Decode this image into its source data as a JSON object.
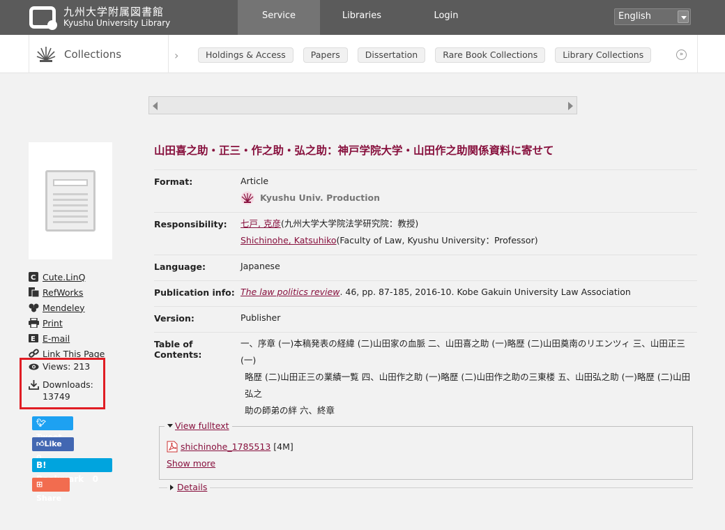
{
  "header": {
    "logo_jp": "九州大学附属図書館",
    "logo_en": "Kyushu University Library",
    "nav": [
      {
        "label": "Service"
      },
      {
        "label": "Libraries"
      },
      {
        "label": "Login"
      }
    ],
    "language": "English"
  },
  "collections_bar": {
    "title": "Collections",
    "pills": [
      "Holdings & Access",
      "Papers",
      "Dissertation",
      "Rare Book Collections",
      "Library Collections"
    ]
  },
  "sidebar": {
    "tools": [
      {
        "label": "Cute.LinQ",
        "icon": "cute-linq-icon"
      },
      {
        "label": "RefWorks",
        "icon": "refworks-icon"
      },
      {
        "label": "Mendeley",
        "icon": "mendeley-icon"
      },
      {
        "label": "Print",
        "icon": "print-icon"
      },
      {
        "label": "E-mail",
        "icon": "email-icon"
      },
      {
        "label": "Link This Page",
        "icon": "link-icon"
      }
    ],
    "views_label": "Views: 213",
    "downloads_label": "Downloads:",
    "downloads_value": "13749",
    "share": {
      "tweet": "Tweet",
      "like": "Like 0",
      "bookmark": "B! Bookmark",
      "bookmark_count": "0",
      "share": "Share"
    }
  },
  "record": {
    "title": "山田喜之助・正三・作之助・弘之助：神戸学院大学・山田作之助関係資料に寄せて",
    "format_label": "Format:",
    "format_value": "Article",
    "production": "Kyushu Univ. Production",
    "responsibility_label": "Responsibility:",
    "resp1_link": "七戸, 克彦",
    "resp1_rest": "(九州大学大学院法学研究院：教授)",
    "resp2_link": "Shichinohe, Katsuhiko",
    "resp2_rest": "(Faculty of Law, Kyushu University：Professor)",
    "language_label": "Language:",
    "language_value": "Japanese",
    "pubinfo_label": "Publication info:",
    "pubinfo_link": "The law politics review",
    "pubinfo_rest": ". 46, pp. 87-185, 2016-10. Kobe Gakuin University Law Association",
    "version_label": "Version:",
    "version_value": "Publisher",
    "toc_label": "Table of Contents:",
    "toc_line1": "一、序章 (一)本稿発表の経緯 (二)山田家の血脈 二、山田喜之助 (一)略歴 (二)山田奠南のリエンツィ 三、山田正三 (一)",
    "toc_line2": "略歴 (二)山田正三の業績一覧 四、山田作之助 (一)略歴 (二)山田作之助の三東楼 五、山田弘之助 (一)略歴 (二)山田弘之",
    "toc_line3": "助の師弟の絆 六、終章"
  },
  "fulltext": {
    "legend": "View fulltext",
    "file_name": "shichinohe_1785513",
    "file_size": "[4M]",
    "show_more": "Show more",
    "details": "Details"
  },
  "colors": {
    "accent": "#87103d",
    "header_bg": "#5b5b5b",
    "highlight": "#e01d24"
  }
}
